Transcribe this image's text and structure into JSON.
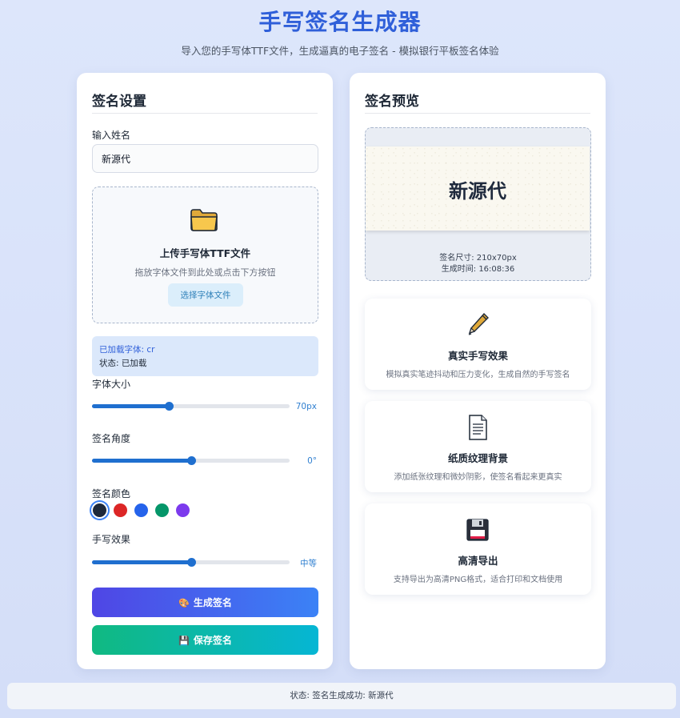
{
  "header": {
    "title": "手写签名生成器",
    "subtitle": "导入您的手写体TTF文件，生成逼真的电子签名 - 模拟银行平板签名体验"
  },
  "settings": {
    "title": "签名设置",
    "name_label": "输入姓名",
    "name_value": "新源代",
    "upload": {
      "icon": "folder-icon",
      "title": "上传手写体TTF文件",
      "hint": "拖放字体文件到此处或点击下方按钮",
      "button": "选择字体文件"
    },
    "font_info": {
      "loaded": "已加载字体: cr",
      "status": "状态: 已加载"
    },
    "font_size": {
      "label": "字体大小",
      "value_text": "70px",
      "fraction": 0.39
    },
    "angle": {
      "label": "签名角度",
      "value_text": "0°",
      "fraction": 0.5
    },
    "color": {
      "label": "签名颜色",
      "options": [
        "#1e293b",
        "#dc2626",
        "#2563eb",
        "#059669",
        "#7c3aed"
      ],
      "selected": 0
    },
    "effect": {
      "label": "手写效果",
      "value_text": "中等",
      "fraction": 0.5
    },
    "generate_button": {
      "icon": "palette-icon",
      "label": "生成签名"
    },
    "save_button": {
      "icon": "floppy-icon",
      "label": "保存签名"
    }
  },
  "preview": {
    "title": "签名预览",
    "signature_text": "新源代",
    "size_text": "签名尺寸: 210x70px",
    "time_text": "生成时间: 16:08:36"
  },
  "features": [
    {
      "icon": "pen-icon",
      "title": "真实手写效果",
      "desc": "模拟真实笔迹抖动和压力变化，生成自然的手写签名"
    },
    {
      "icon": "document-icon",
      "title": "纸质纹理背景",
      "desc": "添加纸张纹理和微妙阴影，使签名看起来更真实"
    },
    {
      "icon": "floppy-icon",
      "title": "高清导出",
      "desc": "支持导出为高清PNG格式，适合打印和文档使用"
    }
  ],
  "status_bar": {
    "text": "状态: 签名生成成功: 新源代"
  },
  "colors": {
    "accent": "#2f5fd9",
    "slider": "#1f6fcf"
  }
}
